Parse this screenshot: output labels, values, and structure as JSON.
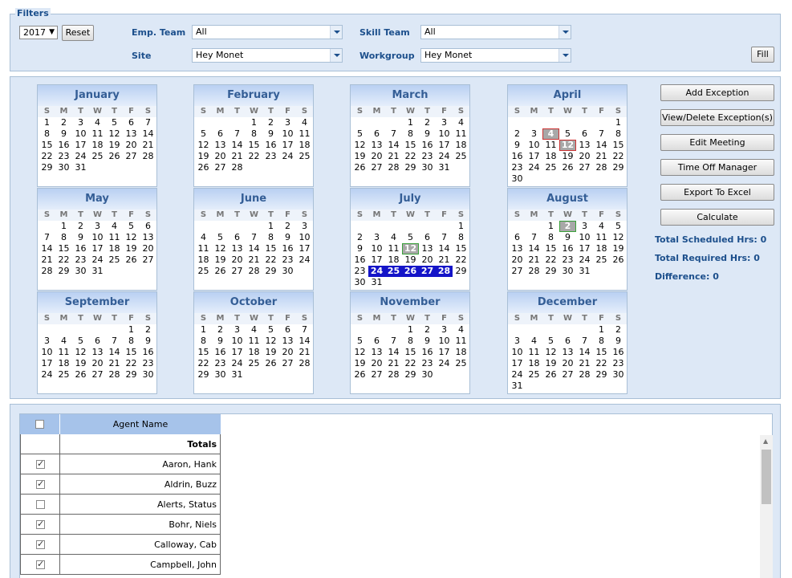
{
  "filters": {
    "legend": "Filters",
    "year": "2017",
    "reset_label": "Reset",
    "emp_team_label": "Emp. Team",
    "emp_team_value": "All",
    "skill_team_label": "Skill Team",
    "skill_team_value": "All",
    "site_label": "Site",
    "site_value": "Hey Monet",
    "workgroup_label": "Workgroup",
    "workgroup_value": "Hey Monet",
    "fill_label": "Fill"
  },
  "weekday_headers": [
    "S",
    "M",
    "T",
    "W",
    "T",
    "F",
    "S"
  ],
  "months": [
    {
      "name": "January",
      "start": 0,
      "days": 31
    },
    {
      "name": "February",
      "start": 3,
      "days": 28
    },
    {
      "name": "March",
      "start": 3,
      "days": 31
    },
    {
      "name": "April",
      "start": 6,
      "days": 30,
      "marks": {
        "4": "exc2",
        "12": "exc2"
      }
    },
    {
      "name": "May",
      "start": 1,
      "days": 31
    },
    {
      "name": "June",
      "start": 4,
      "days": 30
    },
    {
      "name": "July",
      "start": 6,
      "days": 31,
      "marks": {
        "12": "exc3",
        "24": "sel",
        "25": "sel",
        "26": "sel",
        "27": "sel",
        "28": "sel"
      }
    },
    {
      "name": "August",
      "start": 2,
      "days": 31,
      "marks": {
        "2": "exc3"
      }
    },
    {
      "name": "September",
      "start": 5,
      "days": 30
    },
    {
      "name": "October",
      "start": 0,
      "days": 31
    },
    {
      "name": "November",
      "start": 3,
      "days": 30
    },
    {
      "name": "December",
      "start": 5,
      "days": 31
    }
  ],
  "actions": {
    "add_exception": "Add Exception",
    "view_delete_exception": "View/Delete Exception(s)",
    "edit_meeting": "Edit Meeting",
    "time_off_manager": "Time Off Manager",
    "export_to_excel": "Export To Excel",
    "calculate": "Calculate"
  },
  "summary": {
    "total_scheduled": "Total Scheduled Hrs: 0",
    "total_required": "Total Required Hrs: 0",
    "difference": "Difference: 0"
  },
  "grid": {
    "header_name": "Agent Name",
    "totals_label": "Totals",
    "rows": [
      {
        "name": "Aaron, Hank",
        "checked": true
      },
      {
        "name": "Aldrin, Buzz",
        "checked": true
      },
      {
        "name": "Alerts, Status",
        "checked": false
      },
      {
        "name": "Bohr, Niels",
        "checked": true
      },
      {
        "name": "Calloway, Cab",
        "checked": true
      },
      {
        "name": "Campbell, John",
        "checked": true
      }
    ]
  }
}
